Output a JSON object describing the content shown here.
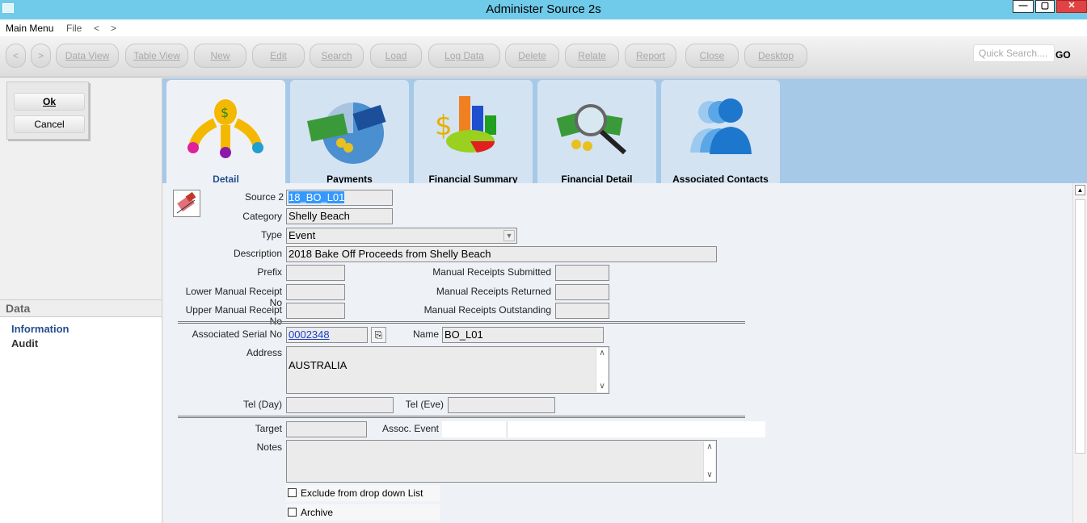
{
  "window": {
    "title": "Administer Source 2s",
    "minimize": "—",
    "maximize": "▢",
    "close": "✕"
  },
  "menu": {
    "main": "Main Menu",
    "file": "File",
    "back": "<",
    "forward": ">"
  },
  "toolbar": {
    "nav_back": "<",
    "nav_forward": ">",
    "buttons": [
      "Data View",
      "Table View",
      "New",
      "Edit",
      "Search",
      "Load",
      "Log Data",
      "Delete",
      "Relate",
      "Report",
      "Close",
      "Desktop"
    ],
    "quick_search_placeholder": "Quick Search....",
    "go": "GO"
  },
  "side": {
    "ok": "Ok",
    "cancel": "Cancel",
    "data_header": "Data",
    "links": [
      "Information",
      "Audit"
    ]
  },
  "tabs": [
    "Detail",
    "Payments",
    "Financial Summary",
    "Financial Detail",
    "Associated Contacts"
  ],
  "form": {
    "source2_label": "Source 2",
    "source2_value": "18_BO_L01",
    "category_label": "Category",
    "category_value": "Shelly Beach",
    "type_label": "Type",
    "type_value": "Event",
    "description_label": "Description",
    "description_value": "2018 Bake Off Proceeds from Shelly Beach",
    "prefix_label": "Prefix",
    "lower_label": "Lower Manual Receipt No",
    "upper_label": "Upper Manual Receipt No",
    "submitted_label": "Manual Receipts Submitted",
    "returned_label": "Manual Receipts Returned",
    "outstanding_label": "Manual Receipts Outstanding",
    "serial_label": "Associated Serial No",
    "serial_value": "0002348",
    "name_label": "Name",
    "name_value": "BO_L01",
    "address_label": "Address",
    "address_value": "AUSTRALIA",
    "tel_day_label": "Tel (Day)",
    "tel_eve_label": "Tel (Eve)",
    "target_label": "Target",
    "assoc_event_label": "Assoc. Event",
    "notes_label": "Notes",
    "exclude_label": "Exclude from drop down List",
    "archive_label": "Archive"
  }
}
